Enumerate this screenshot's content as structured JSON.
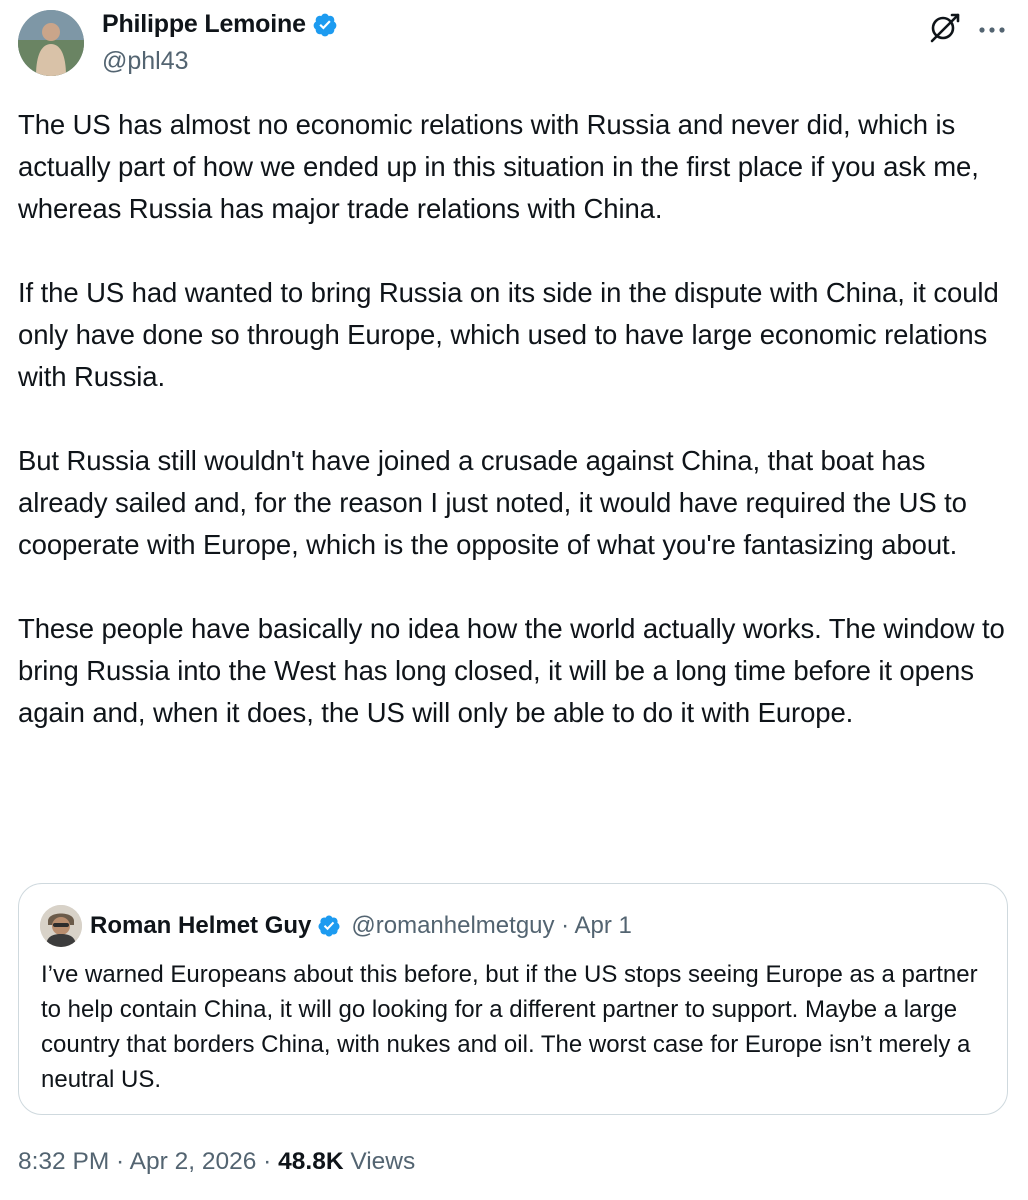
{
  "tweet": {
    "author": {
      "name": "Philippe Lemoine",
      "handle": "@phl43",
      "verified": true,
      "avatar_icon": "profile-photo"
    },
    "paragraphs": [
      "The US has almost no economic relations with Russia and never did, which is actually part of how we ended up in this situation in the first place if you ask me, whereas Russia has major trade relations with China.",
      "If the US had wanted to bring Russia on its side in the dispute with China, it could only have done so through Europe, which used to have large economic relations with Russia.",
      "But Russia still wouldn't have joined a crusade against China, that boat has already sailed and, for the reason I just noted, it would have required the US to cooperate with Europe, which is the opposite of what you're fantasizing about.",
      "These people have basically no idea how the world actually works. The window to bring Russia into the West has long closed, it will be a long time before it opens again and, when it does, the US will only be able to do it with Europe."
    ],
    "footer": {
      "time": "8:32 PM",
      "date": "Apr 2, 2026",
      "views_count": "48.8K",
      "views_label": "Views",
      "separator": " · "
    }
  },
  "quoted_tweet": {
    "author": {
      "name": "Roman Helmet Guy",
      "handle": "@romanhelmetguy",
      "verified": true
    },
    "date": "Apr 1",
    "meta_line": "@romanhelmetguy · Apr 1",
    "text": "I’ve warned Europeans about this before, but if the US stops seeing Europe as a partner to help contain China, it will go looking for a different partner to support. Maybe a large country that borders China, with nukes and oil. The worst case for Europe isn’t merely a neutral US."
  },
  "icons": {
    "verified": "verified-badge-icon",
    "grok": "grok-icon",
    "more": "more-options-icon"
  },
  "colors": {
    "text_primary": "#0f1419",
    "text_secondary": "#536471",
    "verified_blue": "#1d9bf0",
    "border": "#cfd9de",
    "background": "#ffffff"
  }
}
